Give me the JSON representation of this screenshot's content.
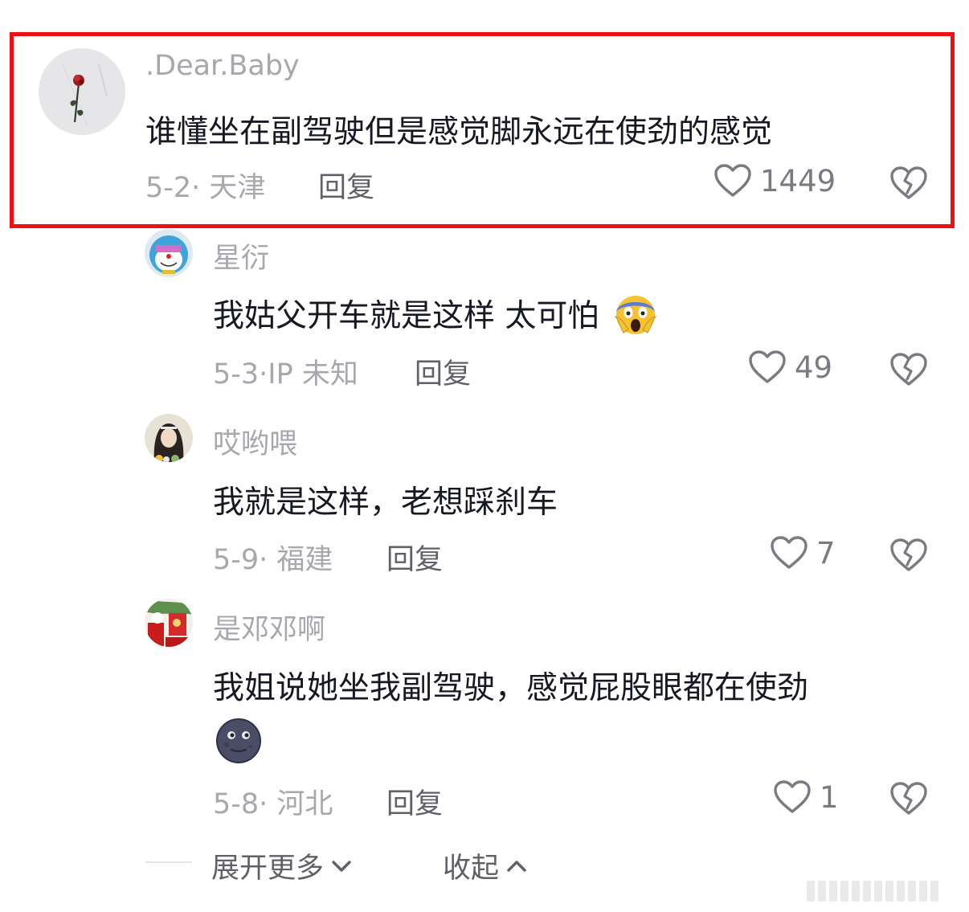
{
  "main_comment": {
    "author": ".Dear.Baby",
    "text": "谁懂坐在副驾驶但是感觉脚永远在使劲的感觉",
    "meta": "5-2· 天津",
    "reply_label": "回复",
    "likes": "1449",
    "avatar_icon": "rose-avatar"
  },
  "replies": [
    {
      "author": "星衍",
      "text": "我姑父开车就是这样 太可怕",
      "emoji": "screaming-face-emoji",
      "meta": "5-3·IP 未知",
      "reply_label": "回复",
      "likes": "49",
      "avatar_icon": "doraemon-avatar"
    },
    {
      "author": "哎哟喂",
      "text": "我就是这样，老想踩刹车",
      "meta": "5-9· 福建",
      "reply_label": "回复",
      "likes": "7",
      "avatar_icon": "girl-avatar"
    },
    {
      "author": "是邓邓啊",
      "text": "我姐说她坐我副驾驶，感觉屁股眼都在使劲",
      "emoji": "new-moon-face-emoji",
      "meta": "5-8· 河北",
      "reply_label": "回复",
      "likes": "1",
      "avatar_icon": "red-decor-avatar"
    }
  ],
  "footer": {
    "expand_label": "展开更多",
    "collapse_label": "收起"
  },
  "colors": {
    "highlight": "#ee1111",
    "meta_text": "#a7a8ad",
    "body_text": "#161823"
  }
}
